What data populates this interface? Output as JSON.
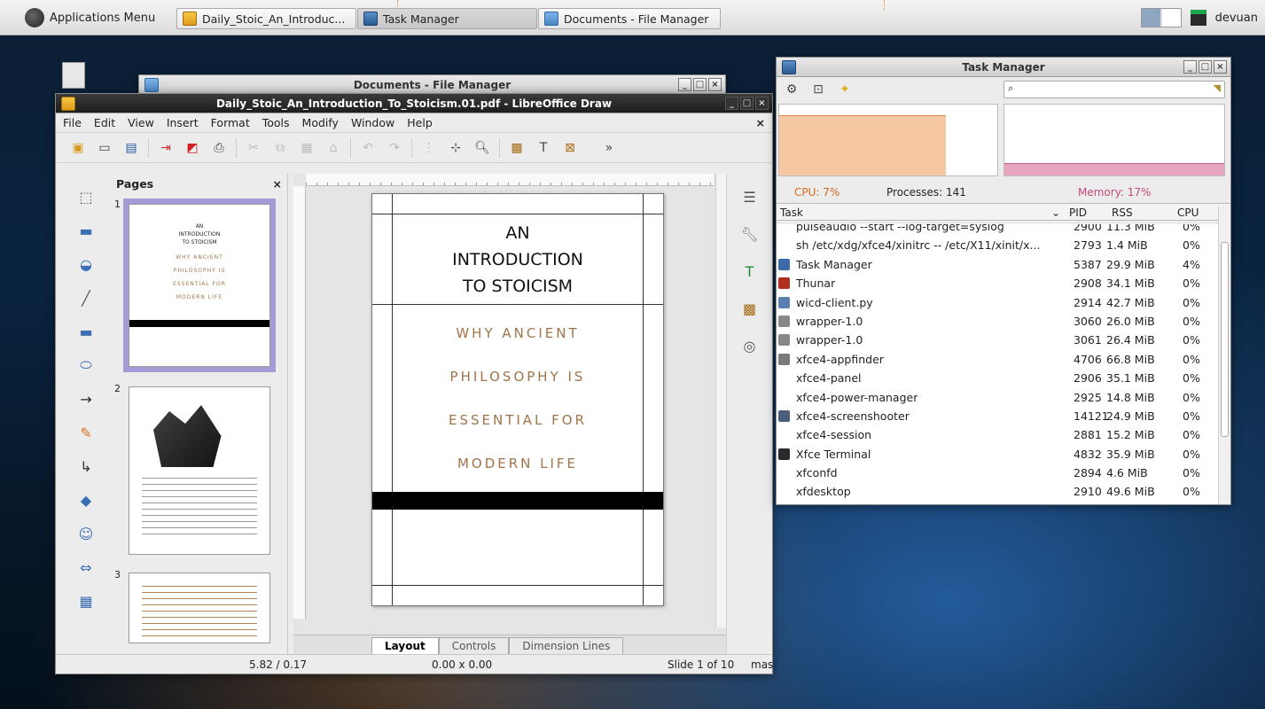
{
  "panel": {
    "app_menu_label": "Applications Menu",
    "tasks": [
      {
        "label": "Daily_Stoic_An_Introduc...",
        "icon": "draw-icon"
      },
      {
        "label": "Task Manager",
        "icon": "task-manager-icon"
      },
      {
        "label": "Documents - File Manager",
        "icon": "folder-icon"
      }
    ],
    "user": "devuan"
  },
  "file_manager": {
    "title": "Documents - File Manager"
  },
  "draw": {
    "title": "Daily_Stoic_An_Introduction_To_Stoicism.01.pdf - LibreOffice Draw",
    "menu": [
      "File",
      "Edit",
      "View",
      "Insert",
      "Format",
      "Tools",
      "Modify",
      "Window",
      "Help"
    ],
    "pages_label": "Pages",
    "thumbnails": [
      "1",
      "2",
      "3"
    ],
    "thumb1_text": {
      "t1": "AN",
      "t2": "INTRODUCTION",
      "t3": "TO STOICISM",
      "s1": "WHY ANCIENT",
      "s2": "PHILOSOPHY IS",
      "s3": "ESSENTIAL FOR",
      "s4": "MODERN LIFE"
    },
    "cover": {
      "title_lines": [
        "AN",
        "INTRODUCTION",
        "TO STOICISM"
      ],
      "subtitle_lines": [
        "WHY ANCIENT",
        "PHILOSOPHY IS",
        "ESSENTIAL FOR",
        "MODERN LIFE"
      ]
    },
    "tabs": [
      "Layout",
      "Controls",
      "Dimension Lines"
    ],
    "status": {
      "position": "5.82 / 0.17",
      "size": "0.00 x 0.00",
      "slide": "Slide 1 of 10",
      "master": "mas"
    },
    "accent": "#a69bd6"
  },
  "task_manager": {
    "title": "Task Manager",
    "cpu": "CPU: 7%",
    "processes": "Processes: 141",
    "memory": "Memory: 17%",
    "columns": [
      "Task",
      "PID",
      "RSS",
      "CPU"
    ],
    "rows": [
      {
        "task": "pulseaudio --start --log-target=syslog",
        "pid": "2900",
        "rss": "11.3 MiB",
        "cpu": "0%",
        "icon": ""
      },
      {
        "task": "sh /etc/xdg/xfce4/xinitrc -- /etc/X11/xinit/x...",
        "pid": "2793",
        "rss": "1.4 MiB",
        "cpu": "0%",
        "icon": ""
      },
      {
        "task": "Task Manager",
        "pid": "5387",
        "rss": "29.9 MiB",
        "cpu": "4%",
        "icon": "task-manager-icon"
      },
      {
        "task": "Thunar",
        "pid": "2908",
        "rss": "34.1 MiB",
        "cpu": "0%",
        "icon": "thunar-icon"
      },
      {
        "task": "wicd-client.py",
        "pid": "2914",
        "rss": "42.7 MiB",
        "cpu": "0%",
        "icon": "window-icon"
      },
      {
        "task": "wrapper-1.0",
        "pid": "3060",
        "rss": "26.0 MiB",
        "cpu": "0%",
        "icon": "wrapper-icon"
      },
      {
        "task": "wrapper-1.0",
        "pid": "3061",
        "rss": "26.4 MiB",
        "cpu": "0%",
        "icon": "wrapper-icon"
      },
      {
        "task": "xfce4-appfinder",
        "pid": "4706",
        "rss": "66.8 MiB",
        "cpu": "0%",
        "icon": "appfinder-icon"
      },
      {
        "task": "xfce4-panel",
        "pid": "2906",
        "rss": "35.1 MiB",
        "cpu": "0%",
        "icon": ""
      },
      {
        "task": "xfce4-power-manager",
        "pid": "2925",
        "rss": "14.8 MiB",
        "cpu": "0%",
        "icon": ""
      },
      {
        "task": "xfce4-screenshooter",
        "pid": "14121",
        "rss": "24.9 MiB",
        "cpu": "0%",
        "icon": "screenshooter-icon"
      },
      {
        "task": "xfce4-session",
        "pid": "2881",
        "rss": "15.2 MiB",
        "cpu": "0%",
        "icon": ""
      },
      {
        "task": "Xfce Terminal",
        "pid": "4832",
        "rss": "35.9 MiB",
        "cpu": "0%",
        "icon": "terminal-icon"
      },
      {
        "task": "xfconfd",
        "pid": "2894",
        "rss": "4.6 MiB",
        "cpu": "0%",
        "icon": ""
      },
      {
        "task": "xfdesktop",
        "pid": "2910",
        "rss": "49.6 MiB",
        "cpu": "0%",
        "icon": ""
      }
    ],
    "cpu_color": "#f6c8a2",
    "mem_color": "#e7a6bf"
  }
}
